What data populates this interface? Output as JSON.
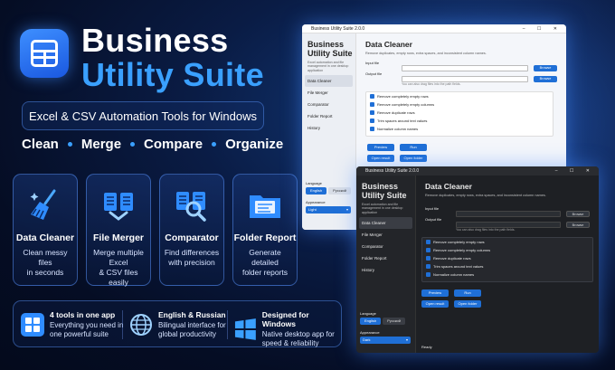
{
  "header": {
    "title_line1": "Business",
    "title_line2": "Utility Suite",
    "subtitle": "Excel & CSV Automation Tools for Windows",
    "actions": [
      "Clean",
      "Merge",
      "Compare",
      "Organize"
    ]
  },
  "cards": [
    {
      "title": "Data Cleaner",
      "desc1": "Clean messy files",
      "desc2": "in seconds",
      "icon": "broom-icon"
    },
    {
      "title": "File Merger",
      "desc1": "Merge multiple Excel",
      "desc2": "& CSV files easily",
      "icon": "merge-files-icon"
    },
    {
      "title": "Comparator",
      "desc1": "Find differences",
      "desc2": "with precision",
      "icon": "compare-magnifier-icon"
    },
    {
      "title": "Folder Report",
      "desc1": "Generate detailed",
      "desc2": "folder reports",
      "icon": "folder-icon"
    }
  ],
  "features": [
    {
      "title": "4 tools in one app",
      "desc1": "Everything you need in",
      "desc2": "one powerful suite",
      "icon": "grid-icon"
    },
    {
      "title": "English & Russian",
      "desc1": "Bilingual interface for",
      "desc2": "global productivity",
      "icon": "globe-icon"
    },
    {
      "title": "Designed for Windows",
      "desc1": "Native desktop app for",
      "desc2": "speed & reliability",
      "icon": "windows-icon"
    }
  ],
  "app": {
    "window_title": "Business Utility Suite 2.0.0",
    "sidebar_title": "Business Utility Suite",
    "sidebar_desc": "Excel automation and file management in one desktop application",
    "nav": [
      "Data Cleaner",
      "File Merger",
      "Comparator",
      "Folder Report",
      "History"
    ],
    "language_label": "Language",
    "lang_en": "English",
    "lang_ru": "Русский",
    "appearance_label": "Appearance",
    "appearance_light": "Light",
    "appearance_dark": "Dark",
    "main_title": "Data Cleaner",
    "main_desc": "Remove duplicates, empty rows, extra spaces, and inconsistent column names.",
    "input_label": "Input file",
    "output_label": "Output file",
    "browse": "Browse",
    "hint": "You can also drag files into the path fields.",
    "options": [
      "Remove completely empty rows",
      "Remove completely empty columns",
      "Remove duplicate rows",
      "Trim spaces around text values",
      "Normalize column names"
    ],
    "preview": "Preview",
    "run": "Run",
    "open_result": "Open result",
    "open_folder": "Open folder",
    "status": "Ready"
  }
}
